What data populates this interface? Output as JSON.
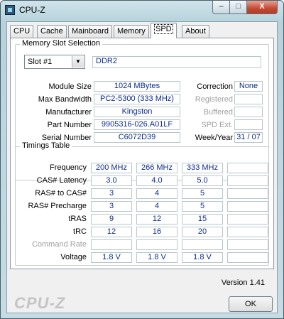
{
  "window": {
    "title": "CPU-Z"
  },
  "controls": {
    "minimize": "–",
    "maximize": "□",
    "close": "X"
  },
  "tabs": [
    {
      "label": "CPU"
    },
    {
      "label": "Cache"
    },
    {
      "label": "Mainboard"
    },
    {
      "label": "Memory"
    },
    {
      "label": "SPD"
    },
    {
      "label": "About"
    }
  ],
  "active_tab": "SPD",
  "slot_selection": {
    "legend": "Memory Slot Selection",
    "selected": "Slot #1",
    "memory_type": "DDR2"
  },
  "module": {
    "module_size_label": "Module Size",
    "module_size": "1024 MBytes",
    "max_bandwidth_label": "Max Bandwidth",
    "max_bandwidth": "PC2-5300 (333 MHz)",
    "manufacturer_label": "Manufacturer",
    "manufacturer": "Kingston",
    "part_number_label": "Part Number",
    "part_number": "9905316-026.A01LF",
    "serial_number_label": "Serial Number",
    "serial_number": "C6072D39",
    "correction_label": "Correction",
    "correction": "None",
    "registered_label": "Registered",
    "registered": "",
    "buffered_label": "Buffered",
    "buffered": "",
    "spd_ext_label": "SPD Ext.",
    "spd_ext": "",
    "week_year_label": "Week/Year",
    "week_year": "31 / 07"
  },
  "timings": {
    "legend": "Timings Table",
    "rows": [
      {
        "label": "Frequency",
        "values": [
          "200 MHz",
          "266 MHz",
          "333 MHz",
          ""
        ],
        "gray": false
      },
      {
        "label": "CAS# Latency",
        "values": [
          "3.0",
          "4.0",
          "5.0",
          ""
        ],
        "gray": false
      },
      {
        "label": "RAS# to CAS#",
        "values": [
          "3",
          "4",
          "5",
          ""
        ],
        "gray": false
      },
      {
        "label": "RAS# Precharge",
        "values": [
          "3",
          "4",
          "5",
          ""
        ],
        "gray": false
      },
      {
        "label": "tRAS",
        "values": [
          "9",
          "12",
          "15",
          ""
        ],
        "gray": false
      },
      {
        "label": "tRC",
        "values": [
          "12",
          "16",
          "20",
          ""
        ],
        "gray": false
      },
      {
        "label": "Command Rate",
        "values": [
          "",
          "",
          "",
          ""
        ],
        "gray": true
      },
      {
        "label": "Voltage",
        "values": [
          "1.8 V",
          "1.8 V",
          "1.8 V",
          ""
        ],
        "gray": false
      }
    ]
  },
  "footer": {
    "version": "Version 1.41",
    "brand": "CPU-Z",
    "ok_label": "OK"
  }
}
